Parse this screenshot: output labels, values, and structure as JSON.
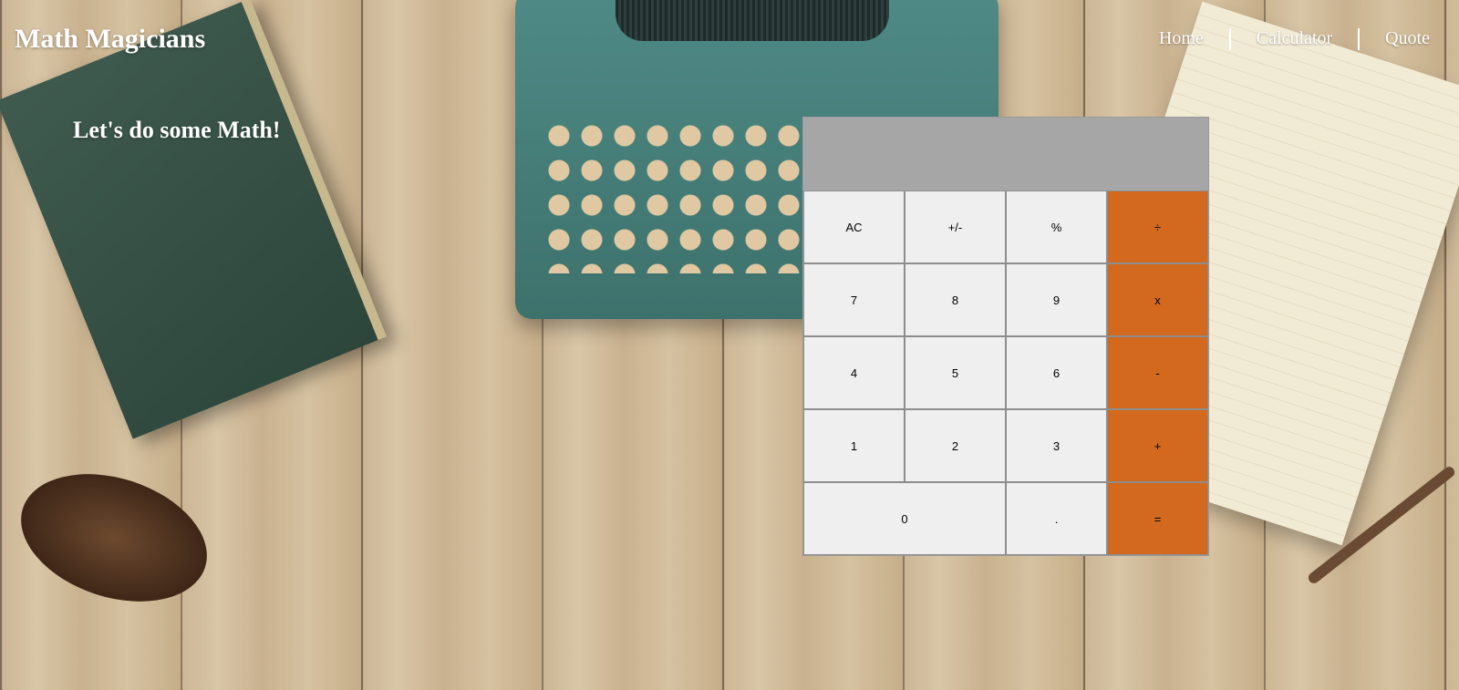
{
  "header": {
    "brand": "Math Magicians",
    "nav": [
      {
        "label": "Home"
      },
      {
        "label": "Calculator"
      },
      {
        "label": "Quote"
      }
    ]
  },
  "main": {
    "intro": "Let's do some Math!"
  },
  "calculator": {
    "display": "",
    "keys": {
      "ac": "AC",
      "sign": "+/-",
      "percent": "%",
      "divide": "÷",
      "seven": "7",
      "eight": "8",
      "nine": "9",
      "multiply": "x",
      "four": "4",
      "five": "5",
      "six": "6",
      "subtract": "-",
      "one": "1",
      "two": "2",
      "three": "3",
      "add": "+",
      "zero": "0",
      "decimal": ".",
      "equals": "="
    }
  },
  "colors": {
    "display_bg": "#a6a6a6",
    "key_bg": "#efefef",
    "operator_bg": "#d2691e"
  }
}
